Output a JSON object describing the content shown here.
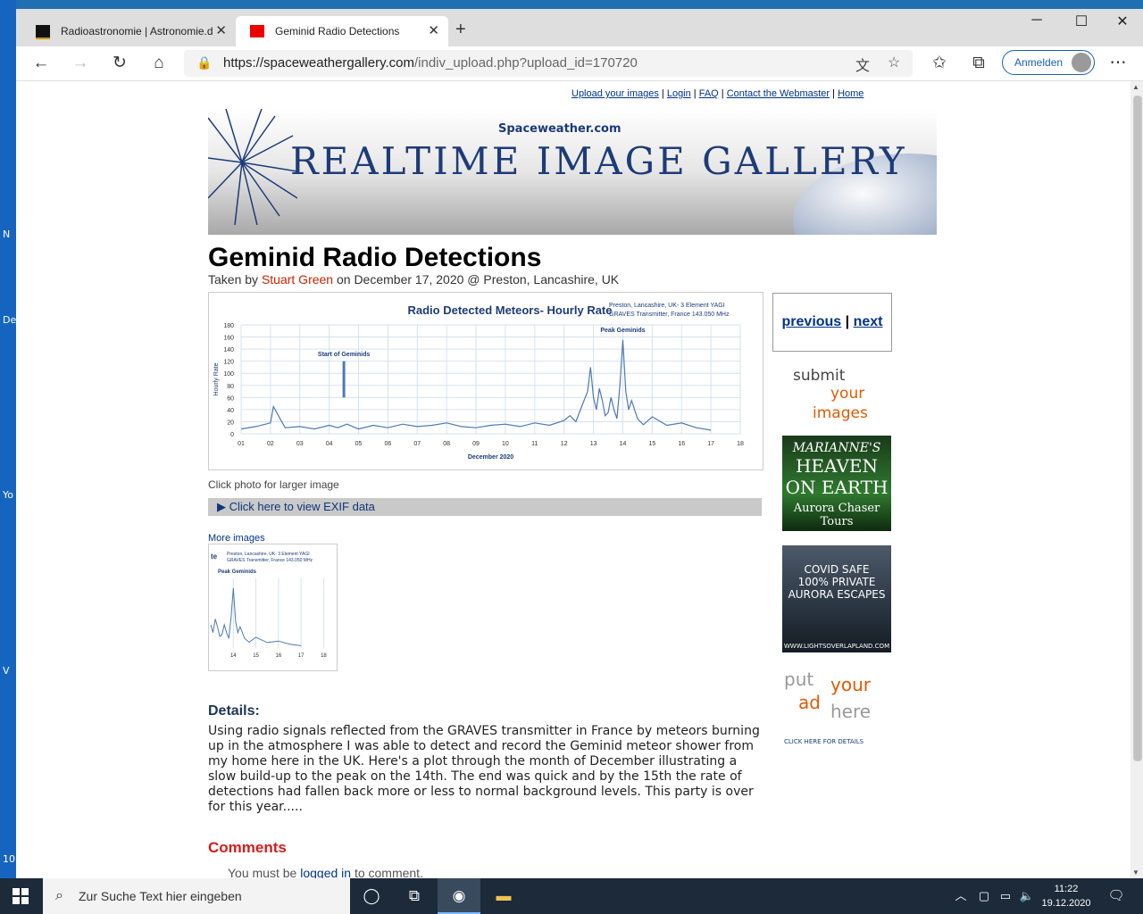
{
  "desktop": {
    "labels": [
      "N",
      "De",
      "Yo",
      "V",
      "10"
    ]
  },
  "browser": {
    "tabs": [
      {
        "title": "Radioastronomie | Astronomie.d"
      },
      {
        "title": "Geminid Radio Detections"
      }
    ],
    "new_tab": "+",
    "url_host": "https://spaceweathergallery.com",
    "url_rest": "/indiv_upload.php?upload_id=170720",
    "signin_label": "Anmelden"
  },
  "page": {
    "top_links": [
      "Upload your images",
      "Login",
      "FAQ",
      "Contact the Webmaster",
      "Home"
    ],
    "banner_site": "Spaceweather.com",
    "banner_title": "REALTIME IMAGE GALLERY",
    "title": "Geminid Radio Detections",
    "taken_prefix": "Taken by",
    "photographer": "Stuart Green",
    "taken_suffix": "on December 17, 2020 @ Preston, Lancashire, UK",
    "caption": "Click photo for larger image",
    "exif_label": "▶  Click here to view EXIF data",
    "more_images": "More images",
    "details_heading": "Details:",
    "details_text": "Using radio signals reflected from the GRAVES transmitter in France by meteors burning up in the atmosphere I was able to detect and record the Geminid meteor shower from my home here in the UK. Here's a plot through the month of December illustrating a slow build-up to the peak on the 14th. The end was quick and by the 15th the rate of detections had fallen back more or less to normal background levels. This party is over for this year.....",
    "comments_heading": "Comments",
    "comments_prefix": "You must be",
    "comments_link": "logged in",
    "comments_suffix": "to comment.",
    "previous": "previous",
    "next": "next",
    "submit_words": [
      "submit",
      "your",
      "images"
    ],
    "ad1_lines": [
      "MARIANNE'S",
      "HEAVEN",
      "ON EARTH",
      "Aurora Chaser Tours"
    ],
    "ad2_lines": [
      "COVID SAFE",
      "100% PRIVATE",
      "AURORA ESCAPES",
      "WWW.LIGHTSOVERLAPLAND.COM"
    ],
    "ad3_words": [
      "put",
      "your",
      "ad",
      "here"
    ],
    "ad3_footer": "CLICK HERE FOR DETAILS"
  },
  "chart_data": {
    "type": "line",
    "title": "Radio Detected Meteors- Hourly Rate",
    "note_lines": [
      "Preston, Lancashire, UK- 3 Element YAGI",
      "GRAVES Transmitter, France 143.050 MHz"
    ],
    "xlabel": "December 2020",
    "ylabel": "Hourly Rate",
    "xticks": [
      "01",
      "02",
      "03",
      "04",
      "05",
      "06",
      "07",
      "08",
      "09",
      "10",
      "11",
      "12",
      "13",
      "14",
      "15",
      "16",
      "17",
      "18"
    ],
    "yticks": [
      0,
      20,
      40,
      60,
      80,
      100,
      120,
      140,
      160,
      180
    ],
    "ylim": [
      0,
      180
    ],
    "xlim": [
      1,
      18
    ],
    "annotations": [
      "Start of Geminids",
      "Peak Geminids"
    ],
    "series_x": [
      1,
      1.5,
      2,
      2.1,
      2.5,
      3,
      3.5,
      4,
      4.3,
      4.6,
      5,
      5.5,
      6,
      6.5,
      7,
      7.5,
      8,
      8.5,
      9,
      9.5,
      10,
      10.5,
      11,
      11.5,
      12,
      12.2,
      12.4,
      12.6,
      12.8,
      12.9,
      13,
      13.1,
      13.2,
      13.3,
      13.4,
      13.5,
      13.6,
      13.7,
      13.8,
      13.9,
      14,
      14.1,
      14.2,
      14.3,
      14.5,
      14.7,
      15,
      15.5,
      16,
      16.5,
      17
    ],
    "series_y": [
      8,
      12,
      18,
      45,
      10,
      12,
      8,
      14,
      10,
      16,
      8,
      14,
      10,
      16,
      12,
      14,
      18,
      12,
      10,
      14,
      16,
      12,
      18,
      14,
      22,
      30,
      20,
      45,
      70,
      110,
      60,
      40,
      75,
      55,
      30,
      35,
      60,
      40,
      25,
      80,
      155,
      70,
      40,
      55,
      25,
      15,
      28,
      14,
      18,
      10,
      6
    ],
    "peak_label": "Peak Geminids"
  }
}
